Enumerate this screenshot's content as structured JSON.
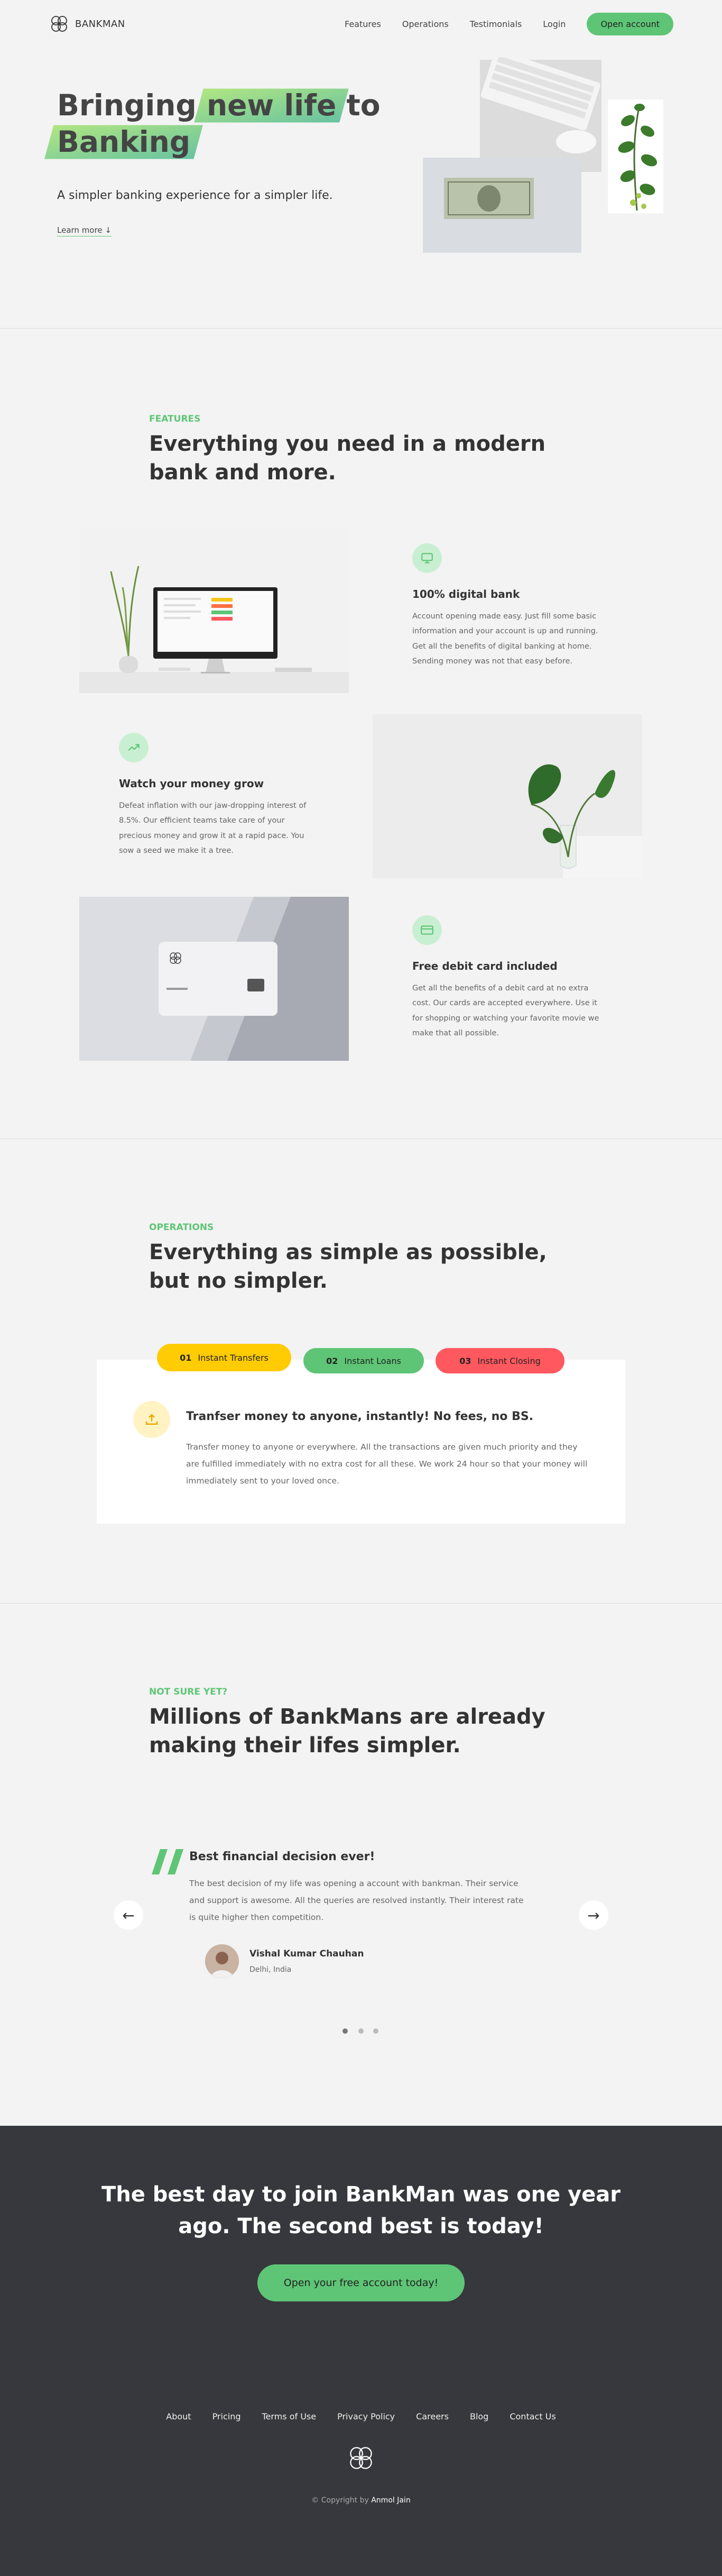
{
  "brand": {
    "name": "BANKMAN",
    "accent": "#5ec576",
    "dark": "#37383d"
  },
  "nav": {
    "links": [
      "Features",
      "Operations",
      "Testimonials",
      "Login"
    ],
    "cta": "Open account"
  },
  "hero": {
    "title_before": "Bringing ",
    "title_highlight_1": "new life",
    "title_middle": " to",
    "title_highlight_2": "Banking",
    "subtitle": "A simpler banking experience for a simpler life.",
    "learn_more": "Learn more ↓"
  },
  "features": {
    "label": "Features",
    "title": "Everything you need in a modern bank and more.",
    "items": [
      {
        "icon": "monitor-icon",
        "title": "100% digital bank",
        "desc": "Account opening made easy. Just fill some basic information and your account is up and running. Get all the benefits of digital banking at home. Sending money was not that easy before."
      },
      {
        "icon": "trending-up-icon",
        "title": "Watch your money grow",
        "desc": "Defeat inflation with our jaw-dropping interest of 8.5%. Our efficient teams take care of your precious money and grow it at a rapid pace. You sow a seed we make it a tree."
      },
      {
        "icon": "credit-card-icon",
        "title": "Free debit card included",
        "desc": "Get all the benefits of a debit card at no extra cost. Our cards are accepted everywhere. Use it for shopping or watching your favorite movie we make that all possible."
      }
    ]
  },
  "operations": {
    "label": "Operations",
    "title": "Everything as simple as possible, but no simpler.",
    "tabs": [
      {
        "num": "01",
        "label": "Instant Transfers",
        "color": "#ffcb03"
      },
      {
        "num": "02",
        "label": "Instant Loans",
        "color": "#5ec576"
      },
      {
        "num": "03",
        "label": "Instant Closing",
        "color": "#ff585f"
      }
    ],
    "content": {
      "icon": "upload-icon",
      "title": "Tranfser money to anyone, instantly! No fees, no BS.",
      "desc": "Transfer money to anyone or everywhere. All the transactions are given much priority and they are fulfilled immediately with no extra cost for all these. We work 24 hour so that your money will immediately sent to your loved once."
    }
  },
  "testimonials": {
    "label": "Not sure yet?",
    "title": "Millions of BankMans are already making their lifes simpler.",
    "quote_title": "Best financial decision ever!",
    "quote_text": "The best decision of my life was opening a account with bankman. Their service and support is awesome. All the queries are resolved instantly. Their interest rate is quite higher then competition.",
    "author": "Vishal Kumar Chauhan",
    "location": "Delhi, India",
    "prev": "←",
    "next": "→"
  },
  "signup": {
    "title": "The best day to join BankMan was one year ago. The second best is today!",
    "cta": "Open your free account today!"
  },
  "footer": {
    "links": [
      "About",
      "Pricing",
      "Terms of Use",
      "Privacy Policy",
      "Careers",
      "Blog",
      "Contact Us"
    ],
    "copyright_prefix": "© Copyright by ",
    "copyright_author": "Anmol Jain"
  }
}
